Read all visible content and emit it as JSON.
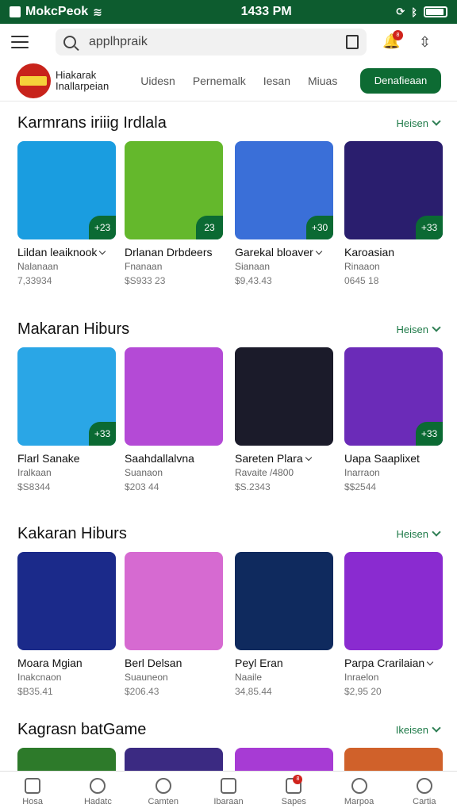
{
  "status_bar": {
    "app_name": "MokcPeok",
    "time": "1433 PM",
    "icons": [
      "wifi-icon",
      "sync-icon",
      "bluetooth-icon",
      "battery-icon"
    ]
  },
  "top_bar": {
    "search_value": "applhpraik",
    "bell_badge": "8"
  },
  "store": {
    "brand_line1": "Hiakarak",
    "brand_line2": "Inallarpeian",
    "nav": [
      "Uidesn",
      "Pernemalk",
      "Iesan",
      "Miuas"
    ],
    "cta_label": "Denafieaan"
  },
  "sections": [
    {
      "title": "Karmrans iriiig Irdlala",
      "see_more": "Heisen",
      "cards": [
        {
          "name": "Lildan leaiknook",
          "sub": "Nalanaan",
          "price": "7,33934",
          "tag": "+23",
          "chevron": true,
          "thumb": "#1a9de0"
        },
        {
          "name": "Drlanan Drbdeers",
          "sub": "Fnanaan",
          "price": "$S933 23",
          "tag": "23",
          "chevron": false,
          "thumb": "#64b82c"
        },
        {
          "name": "Garekal bloaver",
          "sub": "Sianaan",
          "price": "$9,43.43",
          "tag": "+30",
          "chevron": true,
          "thumb": "#3a6fd8"
        },
        {
          "name": "Karoasian",
          "sub": "Rinaaon",
          "price": "0645 18",
          "tag": "+33",
          "chevron": false,
          "thumb": "#2a1e6e"
        }
      ]
    },
    {
      "title": "Makaran Hiburs",
      "see_more": "Heisen",
      "cards": [
        {
          "name": "Flarl Sanake",
          "sub": "Iralkaan",
          "price": "$S8344",
          "tag": "+33",
          "chevron": false,
          "thumb": "#2aa6e6"
        },
        {
          "name": "Saahdallalvna",
          "sub": "Suanaon",
          "price": "$203 44",
          "tag": "",
          "chevron": false,
          "thumb": "#b44ad6"
        },
        {
          "name": "Sareten Plara",
          "sub": "Ravaite /4800",
          "price": "$S.2343",
          "tag": "",
          "chevron": true,
          "thumb": "#1b1b2a"
        },
        {
          "name": "Uapa Saaplixet",
          "sub": "Inarraon",
          "price": "$$2544",
          "tag": "+33",
          "chevron": false,
          "thumb": "#6b2bb8"
        }
      ]
    },
    {
      "title": "Kakaran Hiburs",
      "see_more": "Heisen",
      "cards": [
        {
          "name": "Moara Mgian",
          "sub": "Inakcnaon",
          "price": "$B35.41",
          "tag": "",
          "chevron": false,
          "thumb": "#1b2a8a"
        },
        {
          "name": "Berl Delsan",
          "sub": "Suauneon",
          "price": "$206.43",
          "tag": "",
          "chevron": false,
          "thumb": "#d66ad1"
        },
        {
          "name": "Peyl Eran",
          "sub": "Naaile",
          "price": "34,85.44",
          "tag": "",
          "chevron": false,
          "thumb": "#0f2a5e"
        },
        {
          "name": "Parpa Crarilaian",
          "sub": "Inraelon",
          "price": "$2,95 20",
          "tag": "",
          "chevron": true,
          "thumb": "#8a2bd0"
        }
      ]
    },
    {
      "title": "Kagrasn batGame",
      "see_more": "Ikeisen",
      "cards": [
        {
          "name": "",
          "sub": "",
          "price": "",
          "tag": "",
          "chevron": false,
          "thumb": "#2d7a2a"
        },
        {
          "name": "",
          "sub": "",
          "price": "",
          "tag": "",
          "chevron": false,
          "thumb": "#3b2a82"
        },
        {
          "name": "",
          "sub": "",
          "price": "",
          "tag": "",
          "chevron": false,
          "thumb": "#a73bd4"
        },
        {
          "name": "",
          "sub": "",
          "price": "",
          "tag": "",
          "chevron": false,
          "thumb": "#d0612a"
        }
      ]
    }
  ],
  "tab_bar": [
    {
      "label": "Hosa",
      "icon": "home-icon"
    },
    {
      "label": "Hadatc",
      "icon": "search-icon"
    },
    {
      "label": "Camten",
      "icon": "key-icon"
    },
    {
      "label": "Ibaraan",
      "icon": "document-icon"
    },
    {
      "label": "Sapes",
      "icon": "inbox-icon",
      "badge": "8"
    },
    {
      "label": "Marpoa",
      "icon": "gamepad-icon"
    },
    {
      "label": "Cartia",
      "icon": "profile-icon"
    }
  ]
}
